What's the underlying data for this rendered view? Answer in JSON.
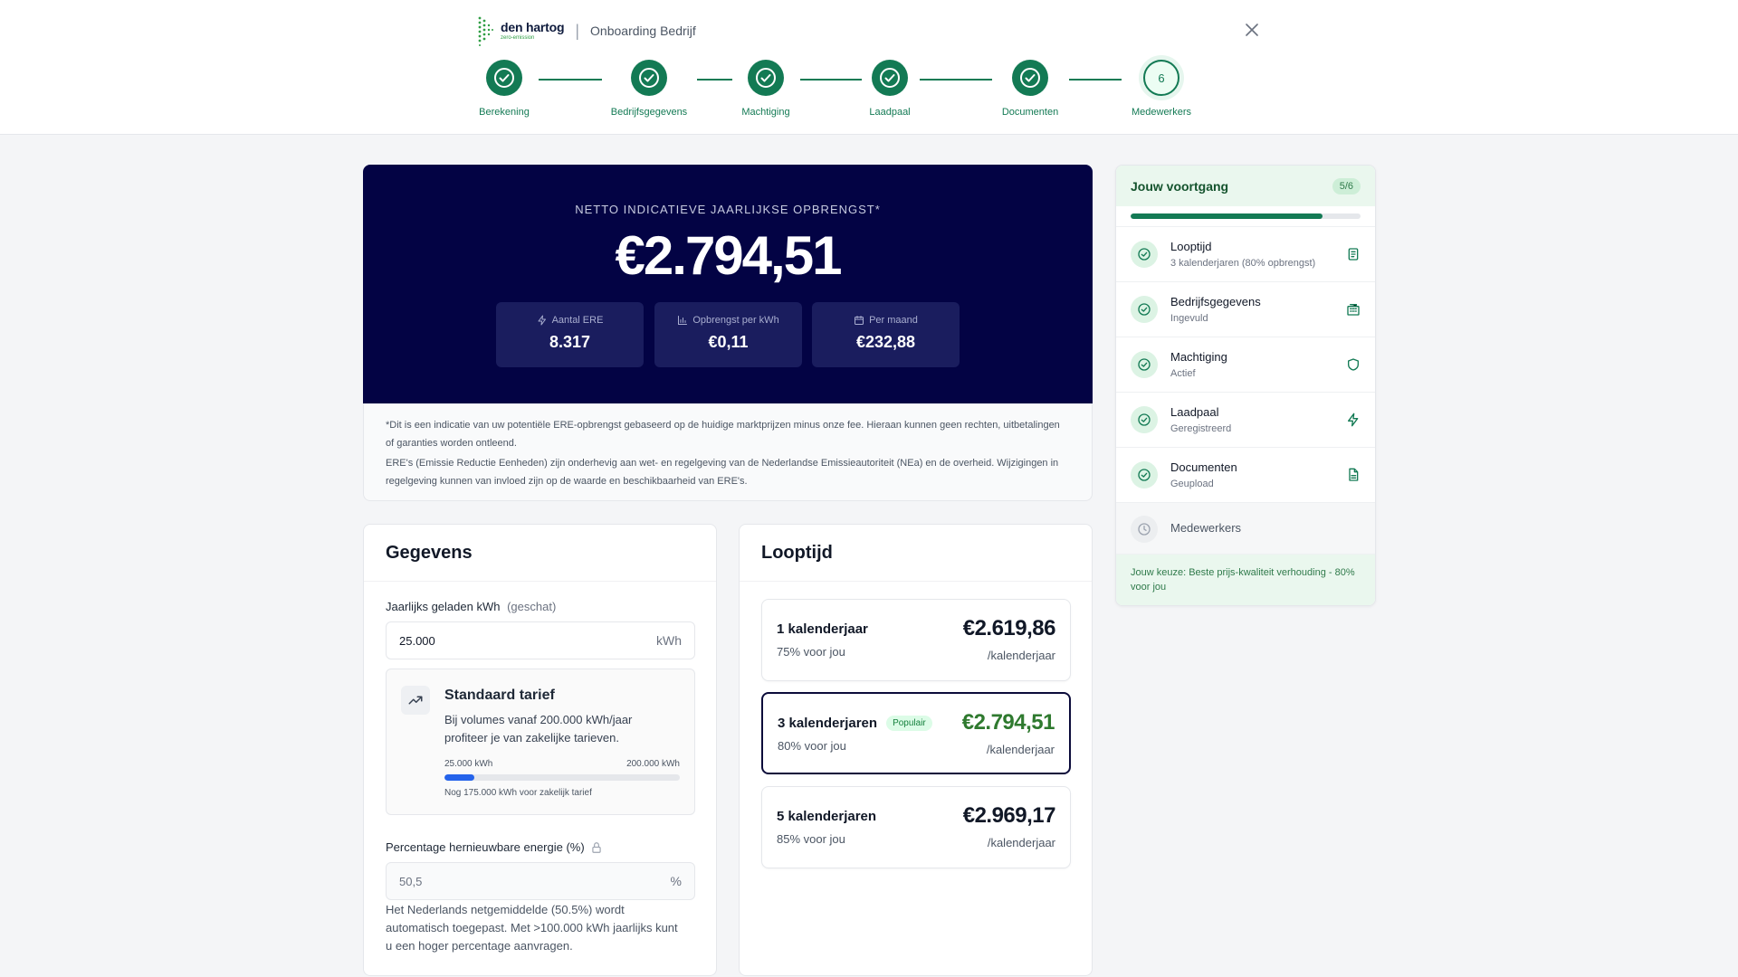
{
  "brand": {
    "name": "den hartog",
    "tagline": "zero-emission",
    "page_title": "Onboarding Bedrijf"
  },
  "stepper": {
    "steps": [
      {
        "label": "Berekening",
        "status": "done"
      },
      {
        "label": "Bedrijfsgegevens",
        "status": "done"
      },
      {
        "label": "Machtiging",
        "status": "done"
      },
      {
        "label": "Laadpaal",
        "status": "done"
      },
      {
        "label": "Documenten",
        "status": "done"
      },
      {
        "label": "Medewerkers",
        "status": "current",
        "number": "6"
      }
    ]
  },
  "hero": {
    "label": "NETTO INDICATIEVE JAARLIJKSE OPBRENGST*",
    "amount": "€2.794,51",
    "stats": [
      {
        "icon": "lightning-icon",
        "label": "Aantal ERE",
        "value": "8.317"
      },
      {
        "icon": "bar-chart-icon",
        "label": "Opbrengst per kWh",
        "value": "€0,11"
      },
      {
        "icon": "calendar-icon",
        "label": "Per maand",
        "value": "€232,88"
      }
    ]
  },
  "disclaimer": {
    "line1": "*Dit is een indicatie van uw potentiële ERE-opbrengst gebaseerd op de huidige marktprijzen minus onze fee. Hieraan kunnen geen rechten, uitbetalingen of garanties worden ontleend.",
    "line2": "ERE's (Emissie Reductie Eenheden) zijn onderhevig aan wet- en regelgeving van de Nederlandse Emissieautoriteit (NEa) en de overheid. Wijzigingen in regelgeving kunnen van invloed zijn op de waarde en beschikbaarheid van ERE's."
  },
  "gegevens": {
    "title": "Gegevens",
    "kwh_label": "Jaarlijks geladen kWh",
    "kwh_hint": "(geschat)",
    "kwh_value": "25.000",
    "kwh_unit": "kWh",
    "tariff": {
      "title": "Standaard tarief",
      "description": "Bij volumes vanaf 200.000 kWh/jaar profiteer je van zakelijke tarieven.",
      "scale_min": "25.000 kWh",
      "scale_max": "200.000 kWh",
      "progress": 0.125,
      "note": "Nog 175.000 kWh voor zakelijk tarief"
    },
    "renewable_label": "Percentage hernieuwbare energie (%)",
    "renewable_value": "50,5",
    "renewable_unit": "%",
    "help": "Het Nederlands netgemiddelde (50.5%) wordt automatisch toegepast. Met >100.000 kWh jaarlijks kunt u een hoger percentage aanvragen."
  },
  "looptijd": {
    "title": "Looptijd",
    "options": [
      {
        "title": "1 kalenderjaar",
        "subtitle": "75% voor jou",
        "price": "€2.619,86",
        "per": "/kalenderjaar",
        "badge": "",
        "selected": false
      },
      {
        "title": "3 kalenderjaren",
        "subtitle": "80% voor jou",
        "price": "€2.794,51",
        "per": "/kalenderjaar",
        "badge": "Populair",
        "selected": true
      },
      {
        "title": "5 kalenderjaren",
        "subtitle": "85% voor jou",
        "price": "€2.969,17",
        "per": "/kalenderjaar",
        "badge": "",
        "selected": false
      }
    ]
  },
  "voortgang": {
    "title": "Jouw voortgang",
    "count": "5/6",
    "progress": 0.833,
    "items": [
      {
        "name": "Looptijd",
        "sub": "3 kalenderjaren (80% opbrengst)",
        "icon": "clipboard-icon",
        "done": true
      },
      {
        "name": "Bedrijfsgegevens",
        "sub": "Ingevuld",
        "icon": "building-icon",
        "done": true
      },
      {
        "name": "Machtiging",
        "sub": "Actief",
        "icon": "shield-icon",
        "done": true
      },
      {
        "name": "Laadpaal",
        "sub": "Geregistreerd",
        "icon": "lightning-icon",
        "done": true
      },
      {
        "name": "Documenten",
        "sub": "Geupload",
        "icon": "document-icon",
        "done": true
      },
      {
        "name": "Medewerkers",
        "sub": "",
        "icon": "clock-icon",
        "done": false
      }
    ],
    "choice": "Jouw keuze: Beste prijs-kwaliteit verhouding - 80% voor jou"
  },
  "colors": {
    "brand_green": "#137a54",
    "hero_navy": "#030344",
    "price_green": "#2f7a2f",
    "tariff_blue": "#2563eb"
  }
}
